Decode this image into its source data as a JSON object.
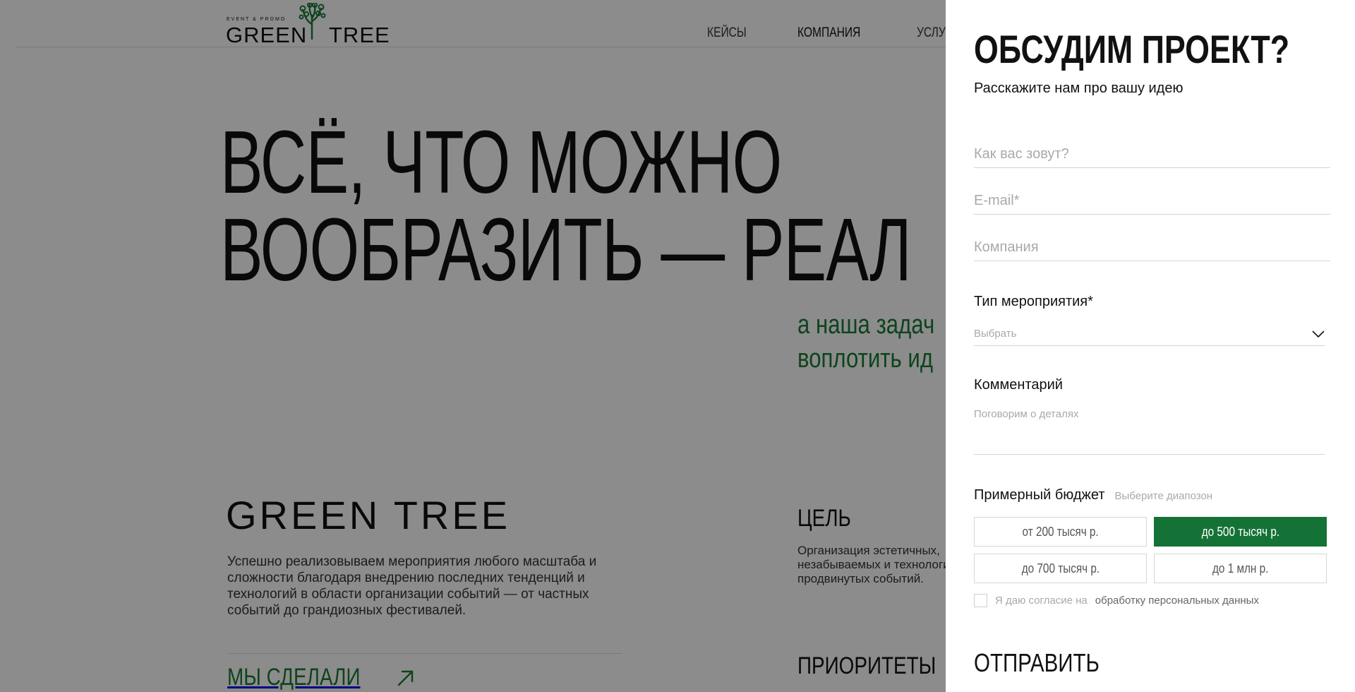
{
  "header": {
    "logo": {
      "tagline": "EVENT & PROMO",
      "word_left": "GREEN",
      "word_right": "TREE"
    },
    "nav": [
      "КЕЙСЫ",
      "КОМПАНИЯ",
      "УСЛУГИ"
    ]
  },
  "hero": {
    "line1": "ВСЁ, ЧТО МОЖНО",
    "line2": "ВООБРАЗИТЬ — РЕАЛ",
    "sub_line1": "а наша задач",
    "sub_line2": "воплотить ид"
  },
  "about": {
    "brand": "GREEN TREE",
    "text": "Успешно реализовываем мероприятия любого масштаба и сложности благодаря внедрению последних тенденций и технологий в области организации событий — от частных событий до грандиозных фестивалей.",
    "link": "МЫ СДЕЛАЛИ",
    "goal_title": "ЦЕЛЬ",
    "goal_text": "Организация эстетичных, незабываемых и технологично продвинутых событий.",
    "priorities_title": "ПРИОРИТЕТЫ"
  },
  "form": {
    "title": "ОБСУДИМ ПРОЕКТ?",
    "subtitle": "Расскажите нам про вашу идею",
    "name_placeholder": "Как вас зовут?",
    "email_placeholder": "E-mail*",
    "company_placeholder": "Компания",
    "event_type_label": "Тип мероприятия*",
    "event_type_value": "Выбрать",
    "comment_label": "Комментарий",
    "comment_placeholder": "Поговорим о деталях",
    "budget_label": "Примерный бюджет",
    "budget_hint": "Выберите диапозон",
    "budget_options": [
      "от 200 тысяч р.",
      "до 500 тысяч р.",
      "до 700 тысяч р.",
      "до 1 млн р."
    ],
    "budget_selected": "до 500 тысяч р.",
    "consent_text": "Я даю согласие на",
    "consent_link": "обработку персональных данных",
    "consent_checked": false,
    "submit_label": "ОТПРАВИТЬ"
  },
  "colors": {
    "accent_green": "#157236",
    "text_green": "#1a7a34",
    "overlay": "rgba(0,0,0,0.45)"
  }
}
